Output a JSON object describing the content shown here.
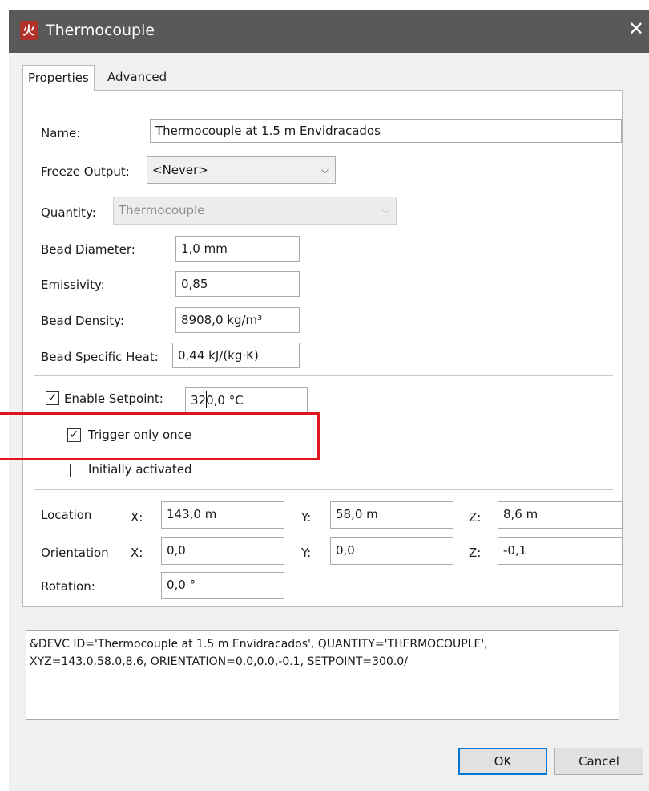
{
  "window": {
    "title": "Thermocouple",
    "close_label": "✕",
    "icon_glyph": "火"
  },
  "tabs": [
    {
      "label": "Properties"
    },
    {
      "label": "Advanced"
    }
  ],
  "properties": {
    "name_label": "Name:",
    "name_value": "Thermocouple at 1.5 m Envidracados",
    "freeze_label": "Freeze Output:",
    "freeze_value": "<Never>",
    "quantity_label": "Quantity:",
    "quantity_value": "Thermocouple",
    "bead_diameter_label": "Bead Diameter:",
    "bead_diameter_value": "1,0 mm",
    "emissivity_label": "Emissivity:",
    "emissivity_value": "0,85",
    "bead_density_label": "Bead Density:",
    "bead_density_value": "8908,0 kg/m³",
    "bead_specific_heat_label": "Bead Specific Heat:",
    "bead_specific_heat_value": "0,44 kJ/(kg·K)",
    "enable_setpoint_label": "Enable Setpoint:",
    "enable_setpoint_checked": true,
    "setpoint_value": "320,0 °C",
    "trigger_once_label": "Trigger only once",
    "trigger_once_checked": true,
    "initially_activated_label": "Initially activated",
    "initially_activated_checked": false,
    "location_label": "Location",
    "orientation_label": "Orientation",
    "rotation_label": "Rotation:",
    "x_label": "X:",
    "y_label": "Y:",
    "z_label": "Z:",
    "location": {
      "x": "143,0 m",
      "y": "58,0 m",
      "z": "8,6 m"
    },
    "orientation": {
      "x": "0,0",
      "y": "0,0",
      "z": "-0,1"
    },
    "rotation_value": "0,0 °"
  },
  "fds_text": "&DEVC ID='Thermocouple at 1.5 m Envidracados', QUANTITY='THERMOCOUPLE',\nXYZ=143.0,58.0,8.6, ORIENTATION=0.0,0.0,-0.1, SETPOINT=300.0/",
  "buttons": {
    "ok": "OK",
    "cancel": "Cancel"
  },
  "colors": {
    "titlebar": "#595959",
    "highlight": "#e0141e",
    "default_button_border": "#0078d7"
  },
  "icons": {
    "check": "✓",
    "dropdown": "⌵"
  }
}
